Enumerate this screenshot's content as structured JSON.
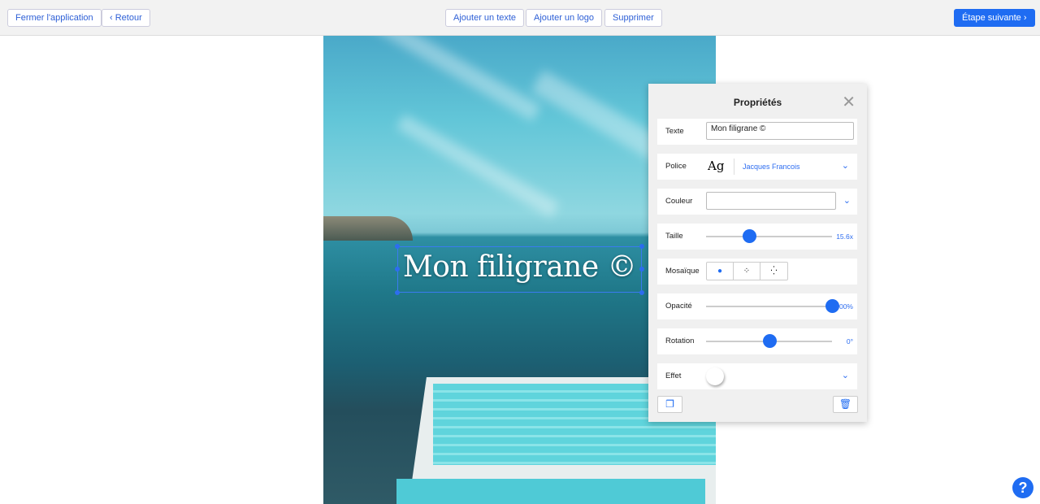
{
  "toolbar": {
    "close_app": "Fermer l'application",
    "back": "Retour",
    "add_text": "Ajouter un texte",
    "add_logo": "Ajouter un logo",
    "delete": "Supprimer",
    "next_step": "Étape suivante"
  },
  "watermark": {
    "text": "Mon filigrane ©"
  },
  "properties": {
    "title": "Propriétés",
    "text_label": "Texte",
    "text_value": "Mon filigrane ©",
    "font_label": "Police",
    "font_preview": "Ag",
    "font_value": "Jacques Francois",
    "color_label": "Couleur",
    "size_label": "Taille",
    "size_value": "15.6x",
    "size_fraction": 0.34,
    "tiling_label": "Mosaïque",
    "opacity_label": "Opacité",
    "opacity_value": "100%",
    "opacity_fraction": 1.0,
    "rotation_label": "Rotation",
    "rotation_value": "0°",
    "rotation_fraction": 0.5,
    "effect_label": "Effet"
  },
  "help": "?",
  "colors": {
    "accent": "#1f6cf2"
  }
}
